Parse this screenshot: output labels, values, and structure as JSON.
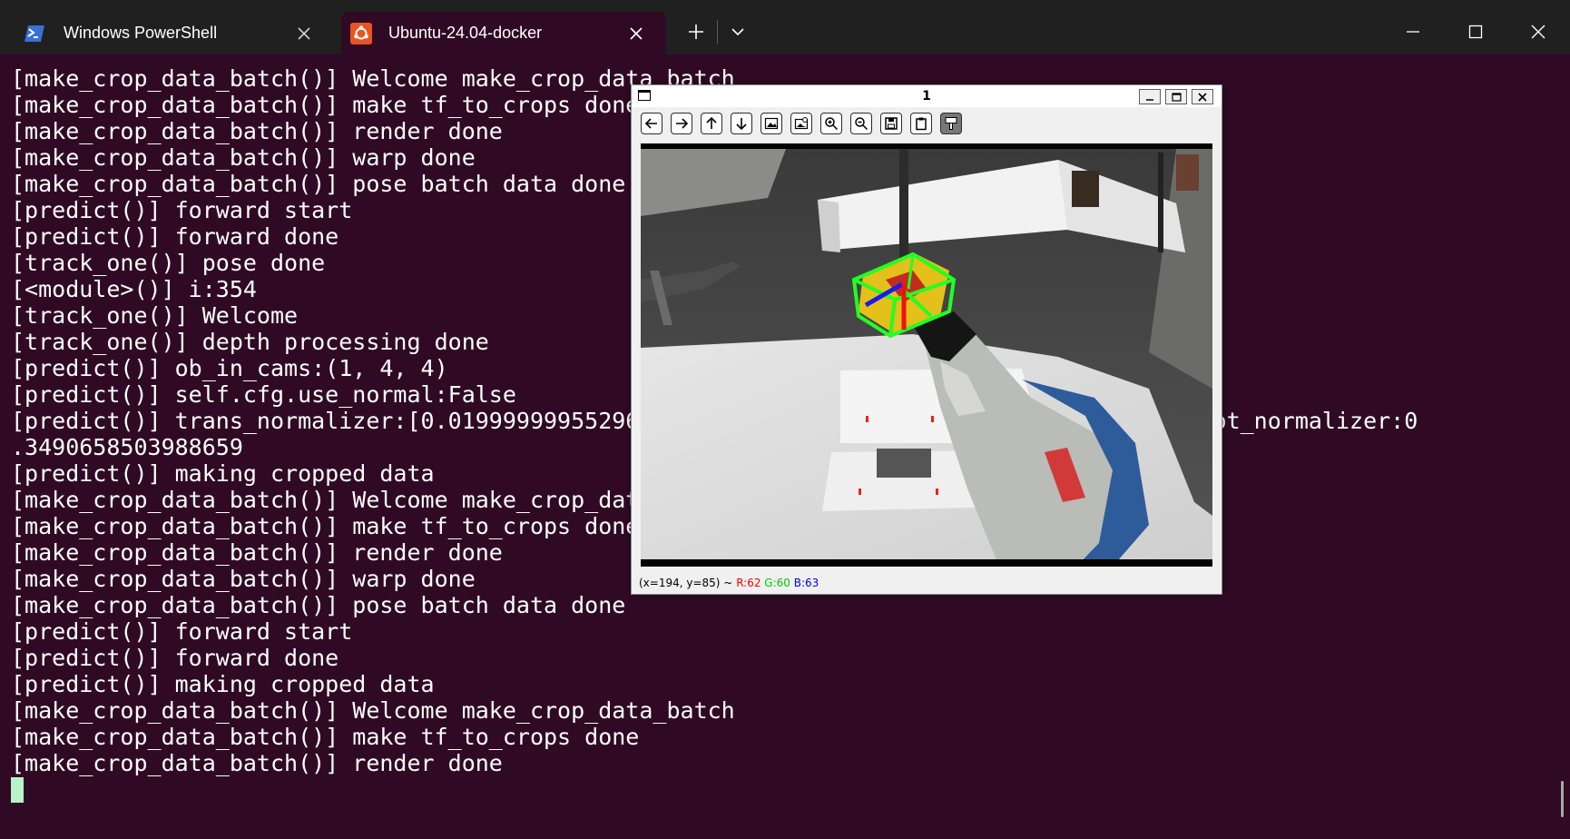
{
  "tabs": [
    {
      "label": "Windows PowerShell",
      "active": false
    },
    {
      "label": "Ubuntu-24.04-docker",
      "active": true
    }
  ],
  "terminal_lines": [
    "[make_crop_data_batch()] Welcome make_crop_data_batch",
    "[make_crop_data_batch()] make tf_to_crops done",
    "[make_crop_data_batch()] render done",
    "[make_crop_data_batch()] warp done",
    "[make_crop_data_batch()] pose batch data done",
    "[predict()] forward start",
    "[predict()] forward done",
    "[track_one()] pose done",
    "[<module>()] i:354",
    "[track_one()] Welcome",
    "[track_one()] depth processing done",
    "[predict()] ob_in_cams:(1, 4, 4)",
    "[predict()] self.cfg.use_normal:False",
    "[predict()] trans_normalizer:[0.01999999955296                                  5806], rot_normalizer:0",
    ".3490658503988659",
    "[predict()] making cropped data",
    "[make_crop_data_batch()] Welcome make_crop_dat",
    "[make_crop_data_batch()] make tf_to_crops done",
    "[make_crop_data_batch()] render done",
    "[make_crop_data_batch()] warp done",
    "[make_crop_data_batch()] pose batch data done",
    "[predict()] forward start",
    "[predict()] forward done",
    "[predict()] making cropped data",
    "[make_crop_data_batch()] Welcome make_crop_data_batch",
    "[make_crop_data_batch()] make tf_to_crops done",
    "[make_crop_data_batch()] render done"
  ],
  "viewer": {
    "title": "1",
    "status": {
      "coords": "(x=194, y=85) ~",
      "r": "R:62",
      "g": "G:60",
      "b": "B:63"
    },
    "toolbar_icons": [
      "arrow-left-icon",
      "arrow-right-icon",
      "arrow-up-icon",
      "arrow-down-icon",
      "image-icon",
      "image-properties-icon",
      "zoom-in-icon",
      "zoom-out-icon",
      "save-icon",
      "clipboard-icon",
      "paint-brush-icon"
    ]
  },
  "colors": {
    "terminal_bg": "#300a24",
    "titlebar_bg": "#202020",
    "status_red": "#ff0000",
    "status_green": "#00cc00",
    "status_blue": "#0000ff"
  }
}
